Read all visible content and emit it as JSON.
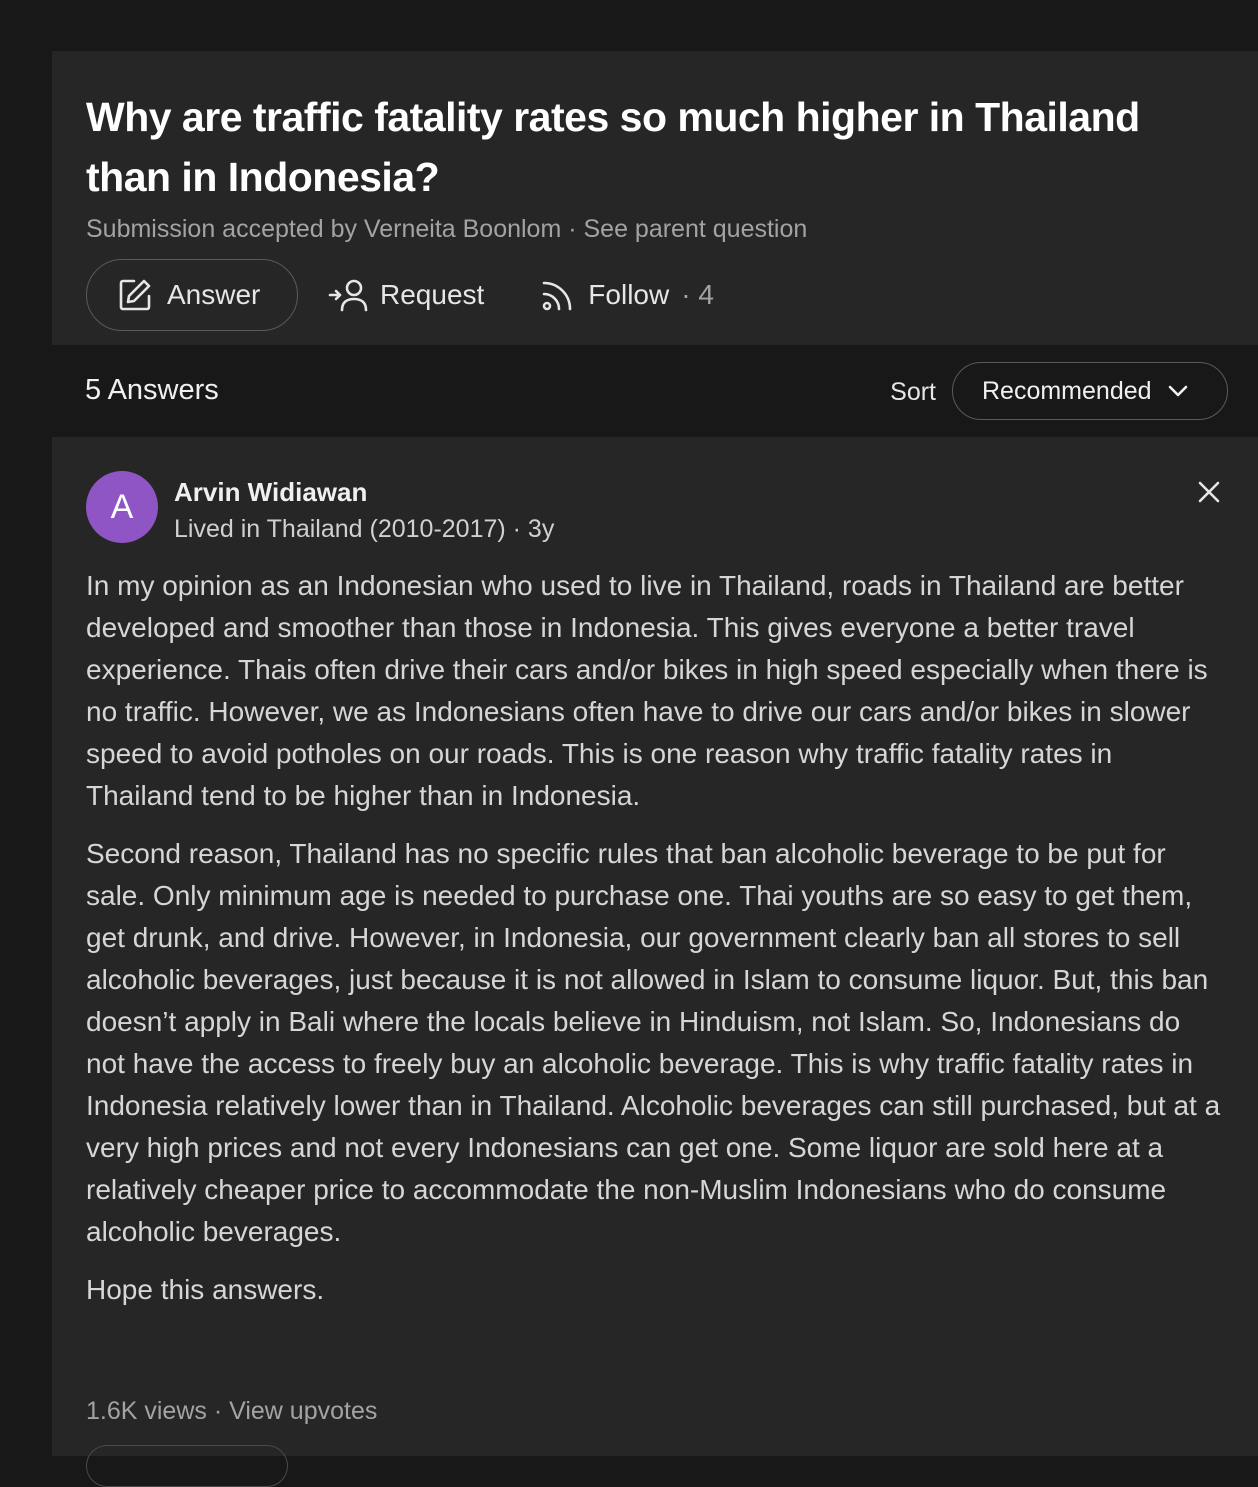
{
  "question": {
    "title": "Why are traffic fatality rates so much higher in Thailand than in Indonesia?",
    "meta": "Submission accepted by Verneita Boonlom",
    "separator": " · ",
    "parent_link": "See parent question",
    "actions": {
      "answer_label": "Answer",
      "request_label": "Request",
      "follow_label": "Follow",
      "follow_count": "· 4"
    }
  },
  "answers_header": {
    "count_label": "5 Answers",
    "sort_label": "Sort",
    "sort_value": "Recommended"
  },
  "answer": {
    "avatar_letter": "A",
    "author": "Arvin Widiawan",
    "credential": "Lived in Thailand (2010-2017) · 3y",
    "paragraphs": [
      "In my opinion as an Indonesian who used to live in Thailand, roads in Thailand are better developed and smoother than those in Indonesia. This gives everyone a better travel experience. Thais often drive their cars and/or bikes in high speed especially when there is no traffic. However, we as Indonesians often have to drive our cars and/or bikes in slower speed to avoid potholes on our roads. This is one reason why traffic fatality rates in Thailand tend to be higher than in Indonesia.",
      "Second reason, Thailand has no specific rules that ban alcoholic beverage to be put for sale. Only minimum age is needed to purchase one. Thai youths are so easy to get them, get drunk, and drive. However, in Indonesia, our government clearly ban all stores to sell alcoholic beverages, just because it is not allowed in Islam to consume liquor. But, this ban doesn’t apply in Bali where the locals believe in Hinduism, not Islam. So, Indonesians do not have the access to freely buy an alcoholic beverage. This is why traffic fatality rates in Indonesia relatively lower than in Thailand. Alcoholic beverages can still purchased, but at a very high prices and not every Indonesians can get one. Some liquor are sold here at a relatively cheaper price to accommodate the non-Muslim Indonesians who do consume alcoholic beverages.",
      "Hope this answers."
    ],
    "views": "1.6K views",
    "separator": " · ",
    "upvotes_link": "View upvotes"
  },
  "colors": {
    "background": "#181818",
    "card": "#262626",
    "avatar": "#8f55c4",
    "muted_text": "#a3a3a3"
  },
  "icons": {
    "answer": "pencil-square-icon",
    "request": "add-person-icon",
    "follow": "rss-icon",
    "sort": "chevron-down-icon",
    "close": "close-icon"
  }
}
